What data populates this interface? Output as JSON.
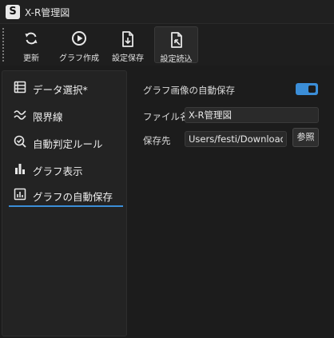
{
  "window": {
    "app_icon_letter": "S",
    "title": "X-R管理図"
  },
  "toolbar": {
    "buttons": [
      {
        "label": "更新",
        "icon": "refresh-icon"
      },
      {
        "label": "グラフ作成",
        "icon": "play-icon"
      },
      {
        "label": "設定保存",
        "icon": "file-save-icon"
      },
      {
        "label": "設定読込",
        "icon": "file-load-icon"
      }
    ]
  },
  "sidebar": {
    "items": [
      {
        "label": "データ選択*",
        "icon": "list-icon"
      },
      {
        "label": "限界線",
        "icon": "limit-lines-icon"
      },
      {
        "label": "自動判定ルール",
        "icon": "check-search-icon"
      },
      {
        "label": "グラフ表示",
        "icon": "bar-chart-icon"
      },
      {
        "label": "グラフの自動保存",
        "icon": "chart-box-icon",
        "selected": true
      }
    ]
  },
  "settings": {
    "autosave_label": "グラフ画像の自動保存",
    "autosave_enabled": true,
    "filename_label": "ファイル名",
    "filename_value": "X-R管理図",
    "savepath_label": "保存先",
    "savepath_value": "Users/festi/Downloads",
    "browse_label": "参照"
  },
  "colors": {
    "accent": "#3b8ed8",
    "background": "#1c1c1c",
    "panel": "#232323"
  }
}
